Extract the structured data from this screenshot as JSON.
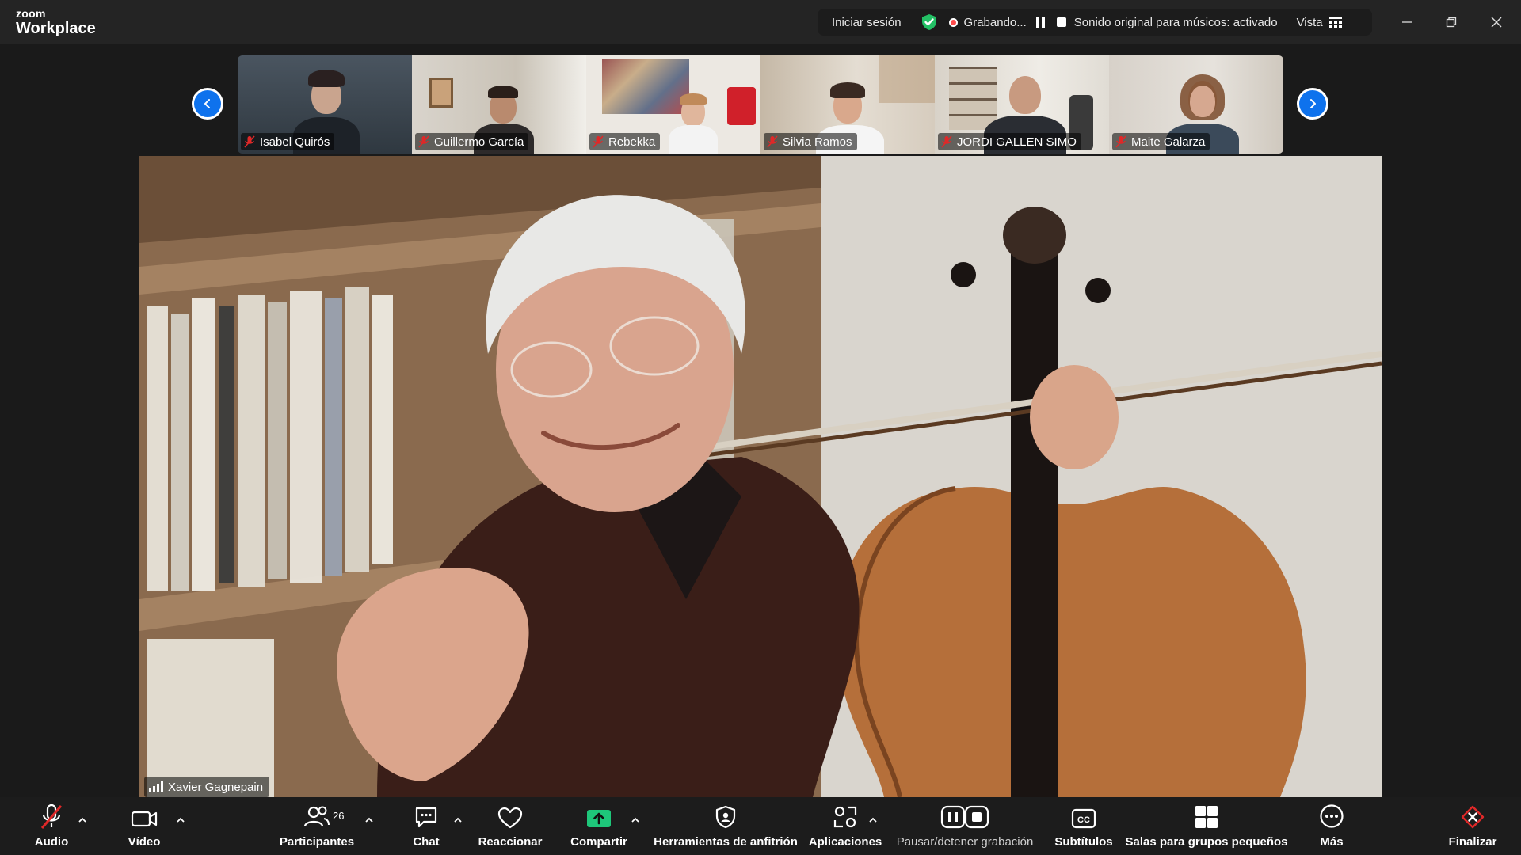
{
  "app": {
    "brand_small": "zoom",
    "brand_large": "Workplace"
  },
  "status": {
    "signin_label": "Iniciar sesión",
    "recording_label": "Grabando...",
    "original_sound_label": "Sonido original para músicos: activado",
    "view_label": "Vista"
  },
  "gallery": {
    "participants": [
      {
        "name": "Isabel Quirós",
        "muted": true
      },
      {
        "name": "Guillermo García",
        "muted": true
      },
      {
        "name": "Rebekka",
        "muted": true
      },
      {
        "name": "Silvia Ramos",
        "muted": true
      },
      {
        "name": "JORDI GALLEN SIMO",
        "muted": true
      },
      {
        "name": "Maite Galarza",
        "muted": true
      }
    ]
  },
  "speaker": {
    "name": "Xavier Gagnepain"
  },
  "toolbar": {
    "audio_label": "Audio",
    "video_label": "Vídeo",
    "participants_label": "Participantes",
    "participants_count": "26",
    "chat_label": "Chat",
    "react_label": "Reaccionar",
    "share_label": "Compartir",
    "host_tools_label": "Herramientas de anfitrión",
    "apps_label": "Aplicaciones",
    "pause_rec_label": "Pausar/detener grabación",
    "captions_label": "Subtítulos",
    "breakout_label": "Salas para grupos pequeños",
    "more_label": "Más",
    "end_label": "Finalizar"
  },
  "colors": {
    "accent_blue": "#0e72ed",
    "share_green": "#1ec77a",
    "end_red": "#e02828",
    "muted_red": "#e02828"
  }
}
